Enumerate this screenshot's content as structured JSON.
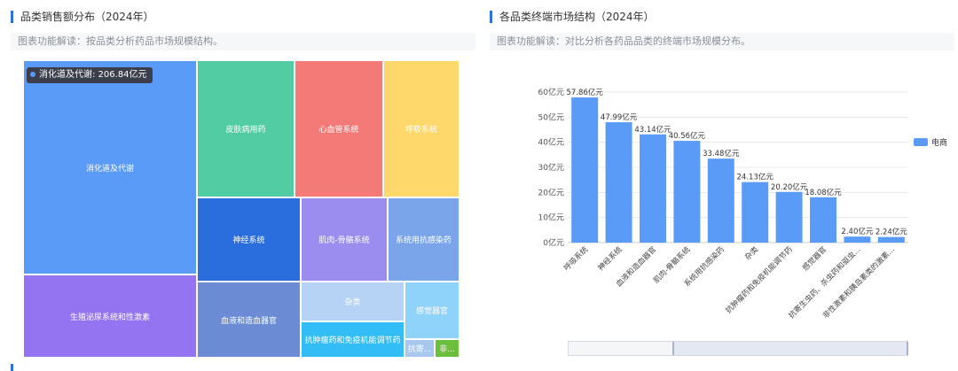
{
  "left_panel": {
    "title": "品类销售额分布（2024年）",
    "description": "图表功能解读：按品类分析药品市场规模结构。",
    "tooltip": "消化道及代谢: 206.84亿元"
  },
  "right_panel": {
    "title": "各品类终端市场结构（2024年）",
    "description": "图表功能解读：对比分析各药品品类的终端市场规模分布。"
  },
  "colors": {
    "accent": "#2f6fe4",
    "bar": "#5b9bf8"
  },
  "chart_data": [
    {
      "type": "treemap",
      "unit": "亿元",
      "nodes": [
        {
          "name": "消化道及代谢",
          "value": 206.84,
          "color": "#5b9bf8"
        },
        {
          "name": "皮肤病用药",
          "color": "#52cca3"
        },
        {
          "name": "心血管系统",
          "color": "#f47a78"
        },
        {
          "name": "呼吸系统",
          "color": "#ffd86b"
        },
        {
          "name": "神经系统",
          "color": "#2a6ede"
        },
        {
          "name": "肌肉-骨骼系统",
          "color": "#9b8cf0"
        },
        {
          "name": "系统用抗感染药",
          "color": "#7ba5ea"
        },
        {
          "name": "生殖泌尿系统和性激素",
          "color": "#9574f1"
        },
        {
          "name": "血液和造血器官",
          "color": "#6b8cd4"
        },
        {
          "name": "杂类",
          "color": "#b6d2f4"
        },
        {
          "name": "感觉器官",
          "color": "#8fd3fb"
        },
        {
          "name": "抗肿瘤药和免疫机能调节药",
          "color": "#33bdf7"
        },
        {
          "name": "抗寄...",
          "color": "#a8c7ee"
        },
        {
          "name": "非...",
          "color": "#6bbf3c"
        }
      ]
    },
    {
      "type": "bar",
      "categories": [
        "呼吸系统",
        "神经系统",
        "血液和造血器官",
        "肌肉-骨骼系统",
        "系统用抗感染药",
        "杂类",
        "抗肿瘤药和免疫机能调节药",
        "感觉器官",
        "抗寄生虫药、杀虫药和驱虫...",
        "非性激素和胰岛素类的激素..."
      ],
      "series": [
        {
          "name": "电商",
          "values": [
            57.86,
            47.99,
            43.14,
            40.56,
            33.48,
            24.13,
            20.2,
            18.08,
            2.4,
            2.24
          ]
        }
      ],
      "labels": [
        "57.86亿元",
        "47.99亿元",
        "43.14亿元",
        "40.56亿元",
        "33.48亿元",
        "24.13亿元",
        "20.20亿元",
        "18.08亿元",
        "2.40亿元",
        "2.24亿元"
      ],
      "y_ticks": [
        "0亿元",
        "10亿元",
        "20亿元",
        "30亿元",
        "40亿元",
        "50亿元",
        "60亿元"
      ],
      "ylim": [
        0,
        60
      ],
      "legend": "right",
      "grid": true
    }
  ]
}
